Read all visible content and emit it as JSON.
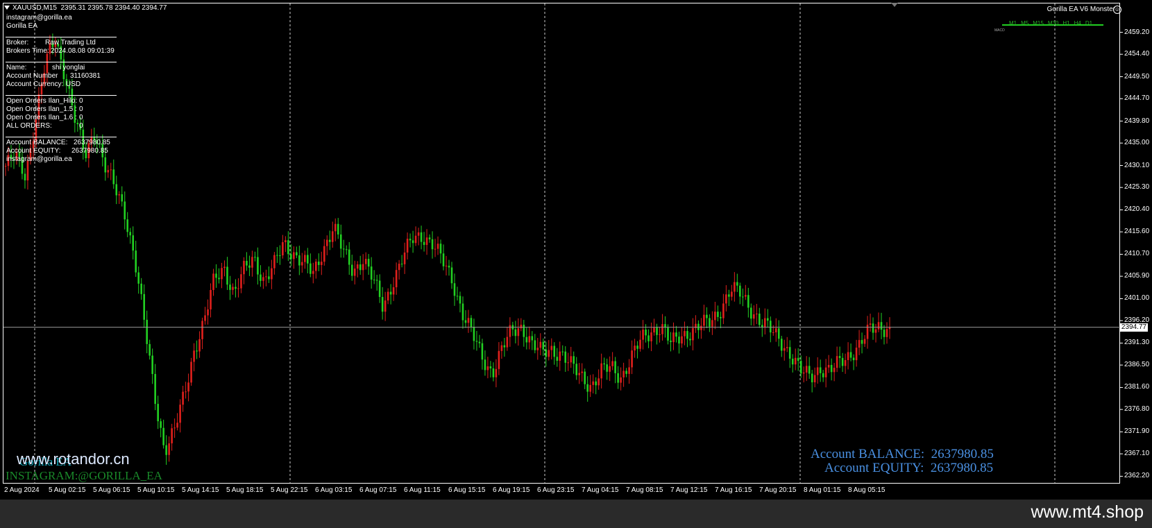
{
  "header": {
    "symbol": "XAUUSD,M15",
    "quote": "2395.31 2395.78 2394.40 2394.77",
    "instagram": "instagram@gorilla.ea",
    "ea": "Gorilla EA"
  },
  "info_panel": {
    "broker_label": "Broker:",
    "broker_value": "Raw Trading Ltd",
    "time_label": "Brokers Time:",
    "time_value": "2024.08.08 09:01:39",
    "name_label": "Name:",
    "name_value": "shi yonglai",
    "acct_num_label": "Account Number",
    "acct_num_value": "31160381",
    "currency_label": "Account Currency:",
    "currency_value": "USD",
    "oo_hilo_label": "Open Orders Ilan_Hilo:",
    "oo_hilo_value": "0",
    "oo_15_label": "Open Orders Ilan_1.5 :",
    "oo_15_value": "0",
    "oo_16_label": "Open Orders Ilan_1.6 :",
    "oo_16_value": "0",
    "all_label": "ALL ORDERS:",
    "all_value": "0",
    "balance_label": "Account BALANCE:",
    "balance_value": "2637980.85",
    "equity_label": "Account EQUITY:",
    "equity_value": "2637980.85",
    "footer": "instagram@gorilla.ea"
  },
  "top_right": {
    "ea_name": "Gorilla EA V6 Monster",
    "timeframes": [
      "M1",
      "M5",
      "M15",
      "M30",
      "H1",
      "H4",
      "D1"
    ],
    "macd": "MACD"
  },
  "overlay": {
    "balance": "Account BALANCE:  2637980.85",
    "equity": "Account EQUITY:  2637980.85",
    "watermark": "www.rotandor.cn",
    "ghost": "Gorilla EA",
    "instagram": "INSTAGRAM:@GORILLA_EA",
    "shop": "www.mt4.shop"
  },
  "current_price": "2394.77",
  "colors": {
    "bull": "#e0201c",
    "bear": "#22d022",
    "background": "#000000",
    "accent": "#4a90e2"
  },
  "chart_data": {
    "type": "candlestick",
    "symbol": "XAUUSD",
    "timeframe": "M15",
    "grid": "vertical dashed",
    "ylim": [
      2360.9,
      2461.1
    ],
    "y_ticks": [
      "2459.20",
      "2454.40",
      "2449.50",
      "2444.70",
      "2439.80",
      "2435.00",
      "2430.10",
      "2425.30",
      "2420.40",
      "2415.60",
      "2410.70",
      "2405.90",
      "2401.00",
      "2396.20",
      "2391.30",
      "2386.50",
      "2381.60",
      "2376.80",
      "2371.90",
      "2367.10",
      "2362.20"
    ],
    "x_ticks": [
      "2 Aug 2024",
      "5 Aug 02:15",
      "5 Aug 06:15",
      "5 Aug 10:15",
      "5 Aug 14:15",
      "5 Aug 18:15",
      "5 Aug 22:15",
      "6 Aug 03:15",
      "6 Aug 07:15",
      "6 Aug 11:15",
      "6 Aug 15:15",
      "6 Aug 19:15",
      "6 Aug 23:15",
      "7 Aug 04:15",
      "7 Aug 08:15",
      "7 Aug 12:15",
      "7 Aug 16:15",
      "7 Aug 20:15",
      "8 Aug 01:15",
      "8 Aug 05:15"
    ],
    "price_path": [
      2430,
      2432,
      2428,
      2440,
      2452,
      2458,
      2450,
      2440,
      2432,
      2438,
      2430,
      2425,
      2420,
      2410,
      2395,
      2380,
      2368,
      2372,
      2380,
      2390,
      2396,
      2405,
      2408,
      2402,
      2407,
      2410,
      2405,
      2408,
      2413,
      2411,
      2409,
      2406,
      2412,
      2417,
      2411,
      2407,
      2410,
      2405,
      2399,
      2405,
      2410,
      2414,
      2415,
      2413,
      2409,
      2405,
      2398,
      2393,
      2388,
      2385,
      2390,
      2394,
      2395,
      2391,
      2389,
      2390,
      2389,
      2386,
      2384,
      2382,
      2385,
      2386,
      2384,
      2388,
      2392,
      2394,
      2395,
      2391,
      2393,
      2394,
      2395,
      2396,
      2399,
      2403,
      2402,
      2399,
      2396,
      2394,
      2392,
      2389,
      2385,
      2384,
      2386,
      2385,
      2387,
      2389,
      2391,
      2394,
      2395,
      2394.77
    ]
  }
}
